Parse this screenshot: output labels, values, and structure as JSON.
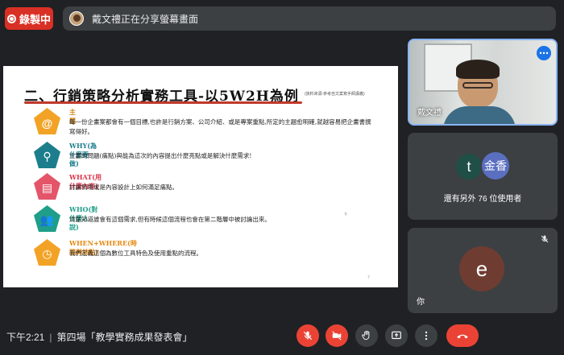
{
  "recording": {
    "label": "錄製中",
    "color": "#d93025"
  },
  "share_banner": {
    "text": "戴文禮正在分享螢幕畫面"
  },
  "slide": {
    "title": "二、行銷策略分析實務工具-以5W2H為例",
    "source": "(資料來源:參考自文案寫手師講義)",
    "page_mark": "7",
    "cursor_mark": "ʰ",
    "items": [
      {
        "icon": "at-sign-icon",
        "glyph": "@",
        "color": "#f2a325",
        "head": "主題",
        "head_color": "#d4831a",
        "text": "每一份企畫案都會有一個目標,也許是行銷方案、公司介紹、或是專案重點,所定的主題愈明確,就越容易把企畫書撰寫得好。"
      },
      {
        "icon": "magnifier-icon",
        "glyph": "⚲",
        "color": "#1c7e8c",
        "head": "WHY(為什麼要做)",
        "head_color": "#1c7e8c",
        "text": "主要的問題(痛點)與能為這次的內容提出什麼亮點或是解決什麼需求!"
      },
      {
        "icon": "document-icon",
        "glyph": "▤",
        "color": "#e4556a",
        "head": "WHAT(用什麼內容)",
        "head_color": "#d9344b",
        "text": "討論情境或是內容設計上如何滿足痛點。"
      },
      {
        "icon": "people-icon",
        "glyph": "👥",
        "color": "#1f9e8a",
        "head": "WHO(對什麼人說)",
        "head_color": "#1f9e8a",
        "text": "清楚知道誰會有這個需求,但有時候這個流程也會在第二階層中被討論出來。"
      },
      {
        "icon": "clock-icon",
        "glyph": "◷",
        "color": "#f2a325",
        "head": "WHEN+WHERE(時間與地點)",
        "head_color": "#e58a12",
        "text": "我們定義這個為數位工具特色及使用重點的流程。"
      }
    ]
  },
  "participants": {
    "presenter_name": "戴文禮",
    "others_avatar_1": "t",
    "others_avatar_2": "金香",
    "others_text": "還有另外 76 位使用者",
    "you_avatar": "e",
    "you_label": "你"
  },
  "bottom_bar": {
    "time": "下午2:21",
    "separator": "|",
    "meeting_title": "第四場「教學實務成果發表會」"
  },
  "controls": [
    {
      "name": "mic-off-button",
      "icon": "mic-off-icon",
      "style": "red"
    },
    {
      "name": "camera-off-button",
      "icon": "camera-off-icon",
      "style": "red"
    },
    {
      "name": "raise-hand-button",
      "icon": "hand-icon",
      "style": "grey"
    },
    {
      "name": "present-button",
      "icon": "present-icon",
      "style": "grey"
    },
    {
      "name": "more-options-button",
      "icon": "more-vert-icon",
      "style": "grey"
    },
    {
      "name": "leave-call-button",
      "icon": "hang-up-icon",
      "style": "end"
    }
  ]
}
